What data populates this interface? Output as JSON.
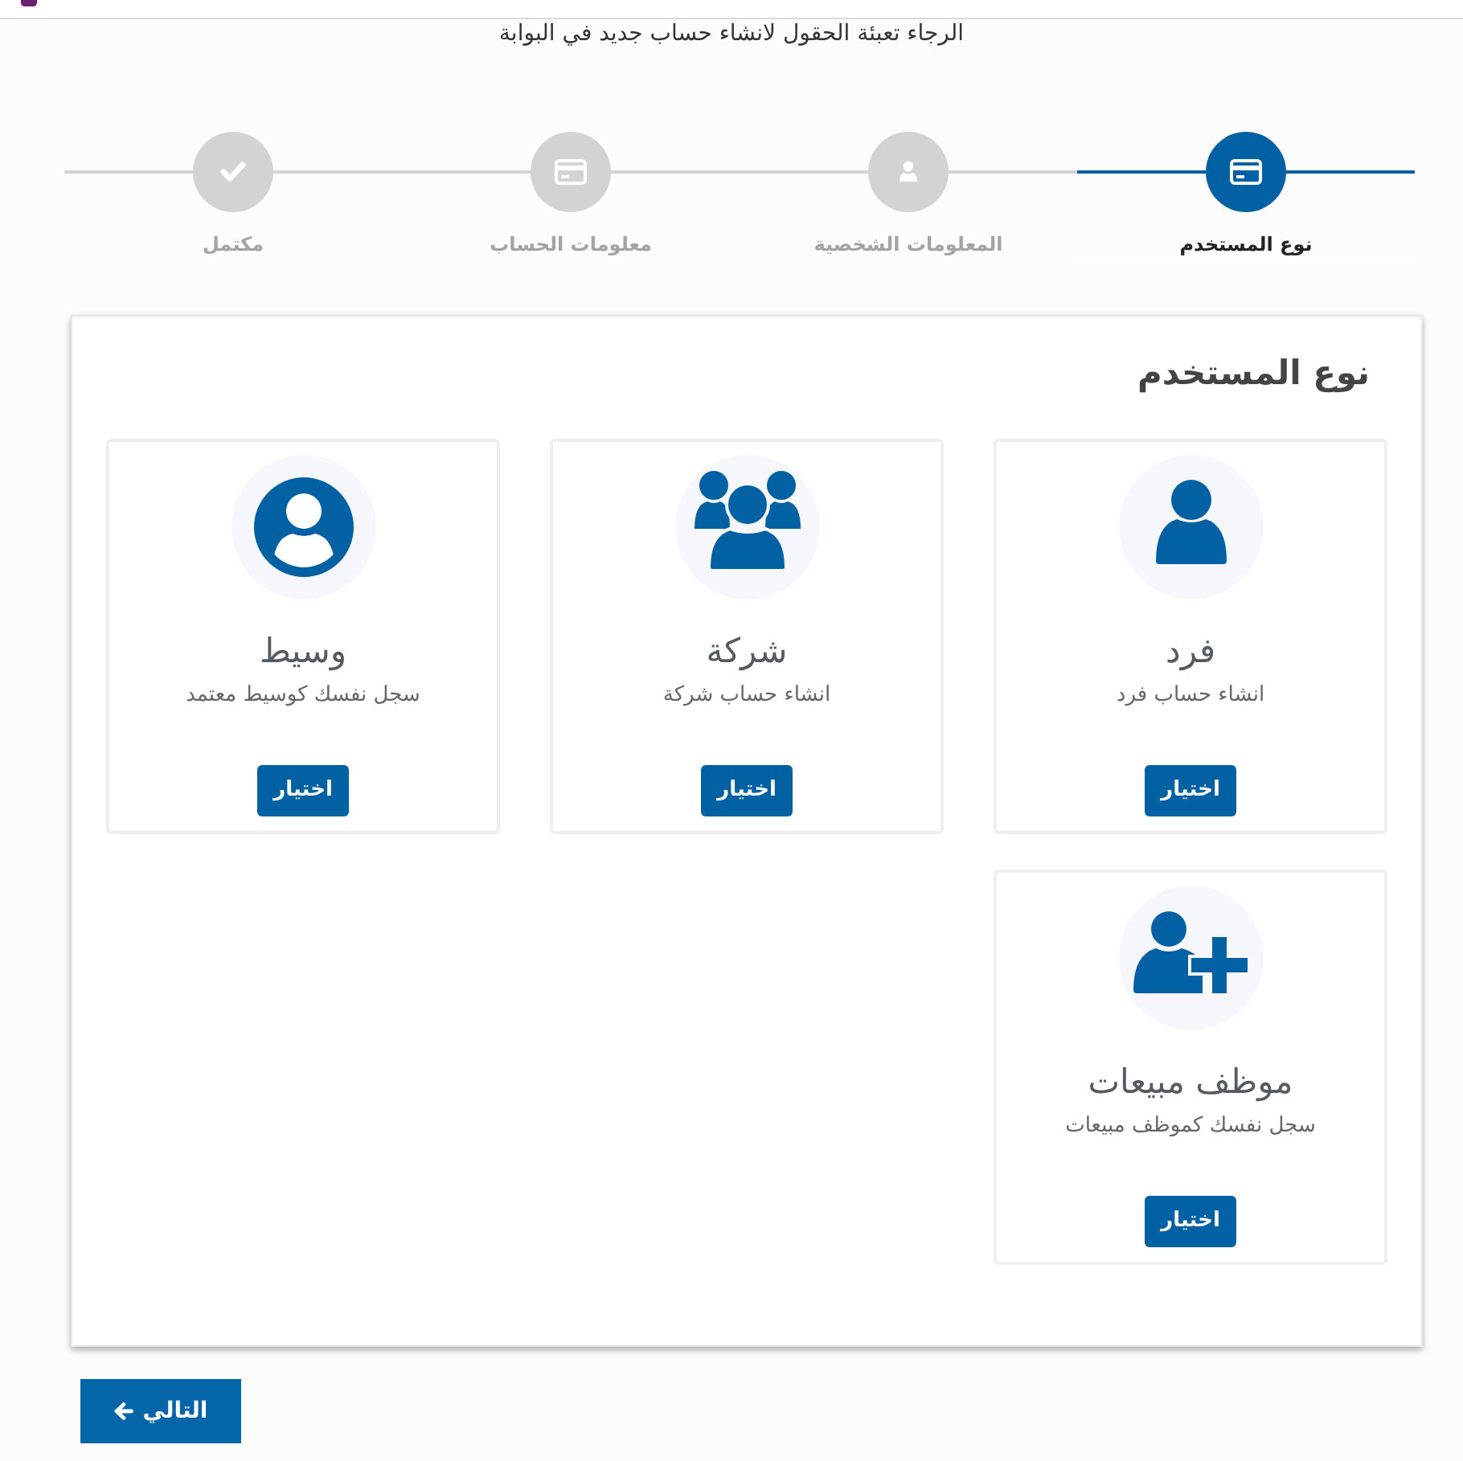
{
  "subtitle": "الرجاء تعبئة الحقول لانشاء حساب جديد في البوابة",
  "steps": [
    {
      "label": "نوع المستخدم",
      "selected": true
    },
    {
      "label": "المعلومات الشخصية",
      "selected": false
    },
    {
      "label": "معلومات الحساب",
      "selected": false
    },
    {
      "label": "مكتمل",
      "selected": false
    }
  ],
  "user_type_card": {
    "title": "نوع المستخدم",
    "options": [
      {
        "title": "فرد",
        "description": "انشاء حساب فرد",
        "button": "اختيار"
      },
      {
        "title": "شركة",
        "description": "انشاء حساب شركة",
        "button": "اختيار"
      },
      {
        "title": "وسيط",
        "description": "سجل نفسك كوسيط معتمد",
        "button": "اختيار"
      },
      {
        "title": "موظف مبيعات",
        "description": "سجل نفسك كموظف مبيعات",
        "button": "اختيار"
      }
    ]
  },
  "next_button": {
    "label": "التالي"
  }
}
